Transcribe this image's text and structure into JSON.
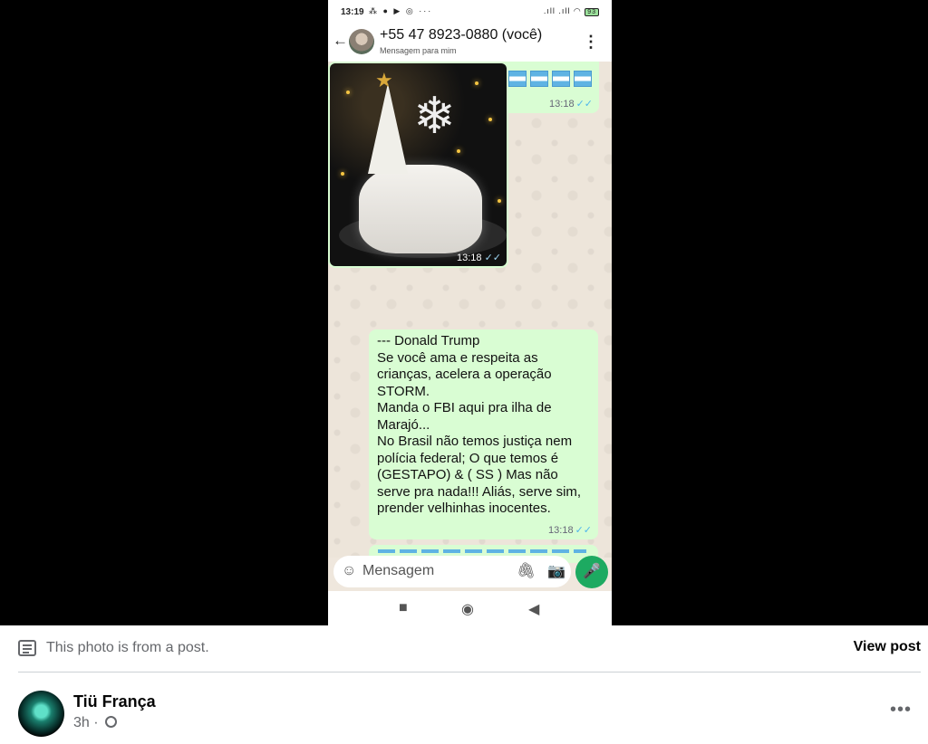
{
  "phone": {
    "status_time": "13:19",
    "status_left_icons": "⁂ ● ▶ ◎  ···",
    "status_right_icons": ".ıll .ıll ◠",
    "battery": "93",
    "contact_name": "+55 47 8923-0880 (você)",
    "contact_sub": "Mensagem para mim",
    "icons": {
      "back": "←",
      "menu": "⋮",
      "forward": "↠",
      "emoji": "☺",
      "clip": "🖇",
      "camera": "📷",
      "mic": "🎤",
      "nav_square": "■",
      "nav_circle": "◉",
      "nav_back": "◀"
    },
    "messages": [
      {
        "type": "flags",
        "time": "13:18",
        "tick": "✓✓"
      },
      {
        "type": "image",
        "time": "13:18",
        "tick": "✓✓"
      },
      {
        "type": "text",
        "text": "--- Donald Trump\nSe você ama e respeita as crianças, acelera a operação STORM.\nManda o FBI aqui pra ilha de Marajó...\nNo Brasil não temos justiça nem polícia federal;  O que temos é (GESTAPO) & ( SS ) Mas não serve pra nada!!!  Aliás, serve sim, prender velhinhas inocentes.",
        "time": "13:18",
        "tick": "✓✓"
      }
    ],
    "composer_placeholder": "Mensagem"
  },
  "caption": {
    "text": "This photo is from a post.",
    "view_post": "View post"
  },
  "author": {
    "name": "Tiü França",
    "time": "3h ·",
    "more": "•••"
  },
  "colors": {
    "bubble": "#d9fdd3",
    "wallpaper": "#ede5da",
    "mic": "#1daa61",
    "fb_secondary": "#65676b"
  }
}
